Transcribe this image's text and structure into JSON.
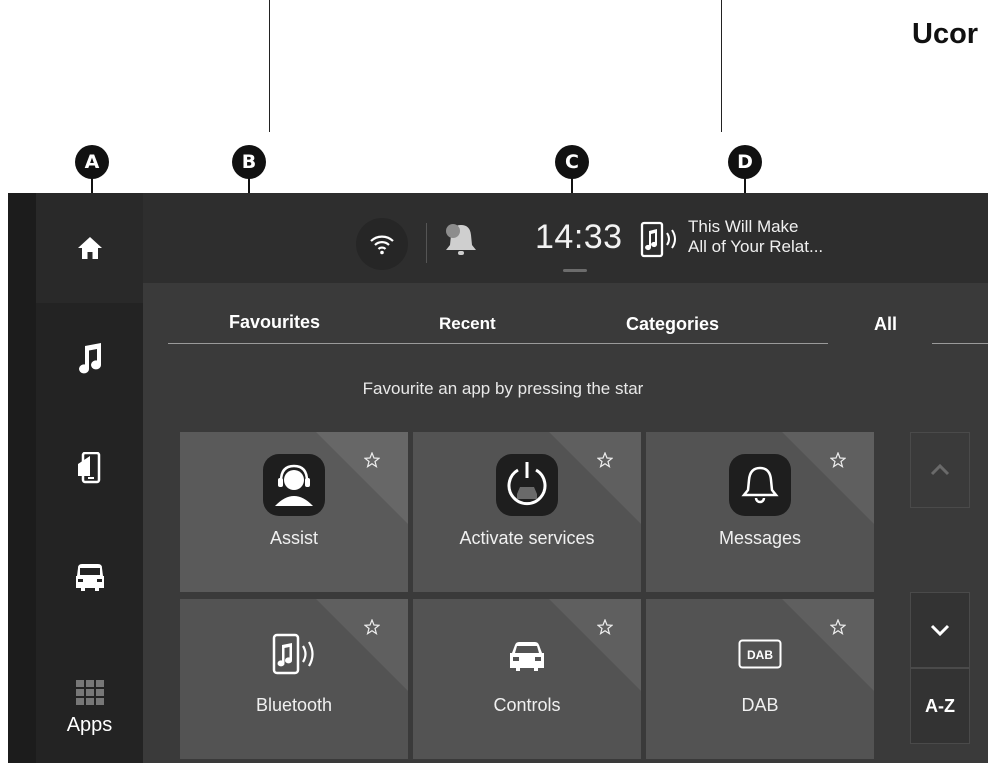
{
  "callouts": {
    "a": "A",
    "b": "B",
    "c": "C",
    "d": "D"
  },
  "heading": "Ucor",
  "sidebar": {
    "items": [
      {
        "icon": "home-icon",
        "label": ""
      },
      {
        "icon": "music-note-icon",
        "label": ""
      },
      {
        "icon": "phone-media-icon",
        "label": ""
      },
      {
        "icon": "van-icon",
        "label": ""
      },
      {
        "icon": "apps-grid-icon",
        "label": "Apps"
      }
    ]
  },
  "status_bar": {
    "clock": "14:33",
    "now_playing_line1": "This Will Make",
    "now_playing_line2": "All of Your Relat..."
  },
  "tabs": [
    "Favourites",
    "Recent",
    "Categories",
    "All"
  ],
  "hint": "Favourite an app by pressing the star",
  "apps": [
    {
      "label": "Assist",
      "icon": "assist-headset-icon"
    },
    {
      "label": "Activate services",
      "icon": "activate-services-icon"
    },
    {
      "label": "Messages",
      "icon": "bell-icon"
    },
    {
      "label": "Bluetooth",
      "icon": "bluetooth-phone-icon"
    },
    {
      "label": "Controls",
      "icon": "car-icon"
    },
    {
      "label": "DAB",
      "icon": "dab-icon",
      "icon_text": "DAB"
    }
  ],
  "scroll": {
    "up": "chevron-up-icon",
    "down": "chevron-down-icon",
    "az_label": "A-Z"
  }
}
